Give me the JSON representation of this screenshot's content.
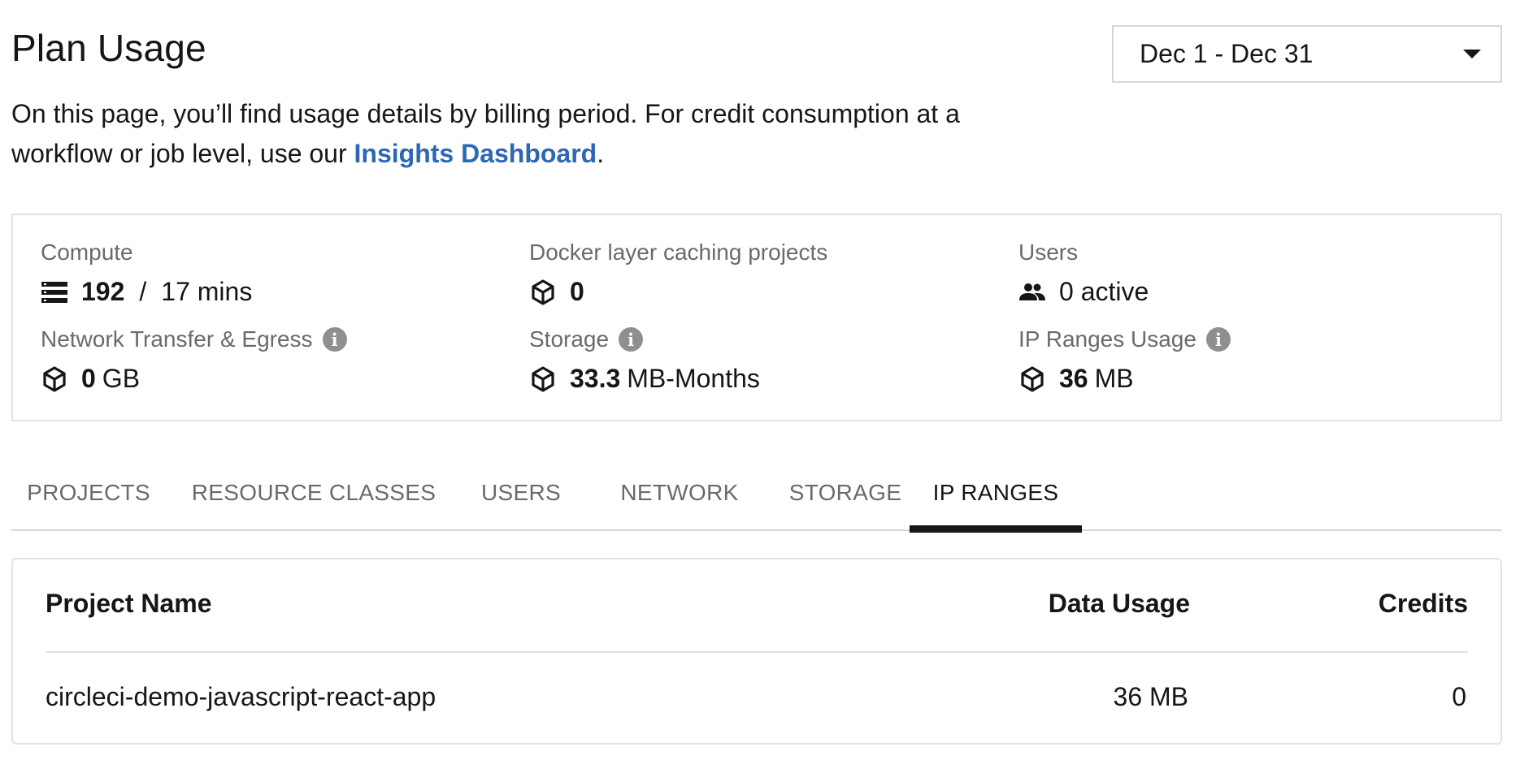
{
  "header": {
    "title": "Plan Usage",
    "date_range": "Dec 1 - Dec 31"
  },
  "intro": {
    "text_before": "On this page, you’ll find usage details by billing period. For credit consumption at a workflow or job level, use our ",
    "link_text": "Insights Dashboard",
    "text_after": "."
  },
  "summary": {
    "compute": {
      "label": "Compute",
      "value": "192",
      "separator": "/",
      "unit": "17 mins",
      "icon": "stack-icon"
    },
    "dlc": {
      "label": "Docker layer caching projects",
      "value": "0",
      "icon": "cube-icon"
    },
    "users": {
      "label": "Users",
      "value": "0 active",
      "icon": "people-icon"
    },
    "network": {
      "label": "Network Transfer & Egress",
      "value": "0",
      "unit": "GB",
      "icon": "cube-icon"
    },
    "storage": {
      "label": "Storage",
      "value": "33.3",
      "unit": "MB-Months",
      "icon": "cube-icon"
    },
    "ip_ranges": {
      "label": "IP Ranges Usage",
      "value": "36",
      "unit": "MB",
      "icon": "cube-icon"
    }
  },
  "tabs": [
    {
      "label": "PROJECTS",
      "active": false
    },
    {
      "label": "RESOURCE CLASSES",
      "active": false
    },
    {
      "label": "USERS",
      "active": false
    },
    {
      "label": "NETWORK",
      "active": false
    },
    {
      "label": "STORAGE",
      "active": false
    },
    {
      "label": "IP RANGES",
      "active": true
    }
  ],
  "table": {
    "columns": [
      "Project Name",
      "Data Usage",
      "Credits"
    ],
    "rows": [
      [
        "circleci-demo-javascript-react-app",
        "36 MB",
        "0"
      ]
    ]
  },
  "colors": {
    "link": "#2d68b5",
    "text": "#161616",
    "muted": "#6a6a6a",
    "border": "#e2e2e2"
  }
}
